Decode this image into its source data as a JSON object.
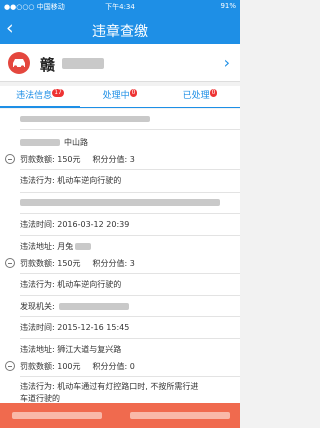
{
  "status_bar": {
    "carrier": "●●○○○ 中国移动",
    "time": "下午4:34",
    "battery": "91%"
  },
  "nav": {
    "title": "违章查缴",
    "back_glyph": "‹"
  },
  "car": {
    "plate_prefix": "赣",
    "chevron": "›"
  },
  "tabs": [
    {
      "label": "违法信息",
      "badge": "17"
    },
    {
      "label": "处理中",
      "badge": "0"
    },
    {
      "label": "已处理",
      "badge": "0"
    }
  ],
  "records": {
    "r0": {
      "address_suffix": "中山路"
    },
    "r1": {
      "fine": "罚款数额:  150元",
      "score": "积分分值:  3",
      "behavior": "违法行为:  机动车逆向行驶的",
      "time": "违法时间:  2016-03-12 20:39",
      "place": "违法地址:  月兔"
    },
    "r2": {
      "fine": "罚款数额:  150元",
      "score": "积分分值:  3",
      "behavior": "违法行为:  机动车逆向行驶的",
      "organ": "发现机关:",
      "time": "违法时间:  2015-12-16 15:45",
      "place": "违法地址:  狮江大道与复兴路"
    },
    "r3": {
      "fine": "罚款数额:  100元",
      "score": "积分分值:  0",
      "behavior_line1": "违法行为:  机动车通过有灯控路口时, 不按所需行进",
      "behavior_line2": "车道行驶的"
    }
  }
}
